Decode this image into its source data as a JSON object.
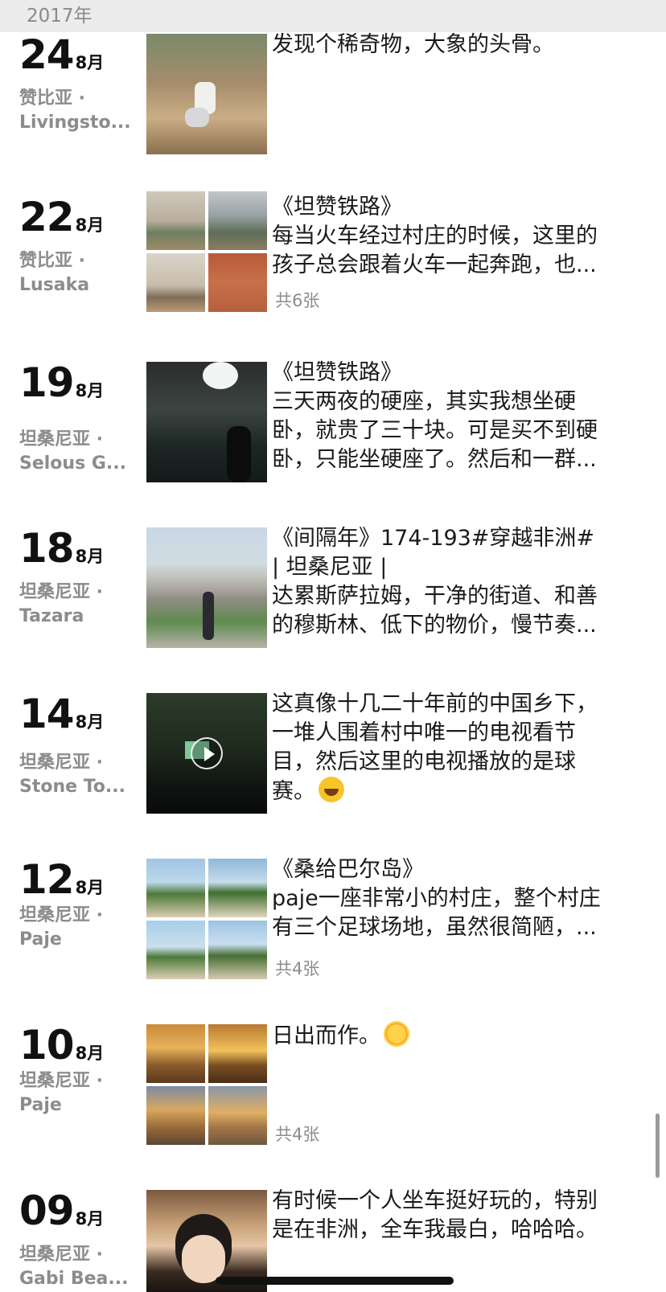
{
  "year_header": "2017年",
  "entries": [
    {
      "day": "24",
      "month": "8月",
      "place_line1": "赞比亚 ·",
      "place_line2": "Livingsto...",
      "lines": [
        "发现个稀奇物，大象的头骨。"
      ],
      "count": ""
    },
    {
      "day": "22",
      "month": "8月",
      "place_line1": "赞比亚 ·",
      "place_line2": "Lusaka",
      "lines": [
        "《坦赞铁路》",
        "每当火车经过村庄的时候，这里的",
        "孩子总会跟着火车一起奔跑，也..."
      ],
      "count": "共6张"
    },
    {
      "day": "19",
      "month": "8月",
      "place_line1": "坦桑尼亚 ·",
      "place_line2": "Selous G...",
      "lines": [
        "《坦赞铁路》",
        "三天两夜的硬座，其实我想坐硬",
        "卧，就贵了三十块。可是买不到硬",
        "卧，只能坐硬座了。然后和一群..."
      ],
      "count": ""
    },
    {
      "day": "18",
      "month": "8月",
      "place_line1": "坦桑尼亚 ·",
      "place_line2": "Tazara",
      "lines": [
        "《间隔年》174-193#穿越非洲#",
        "| 坦桑尼亚 |",
        "达累斯萨拉姆，干净的街道、和善",
        "的穆斯林、低下的物价，慢节奏..."
      ],
      "count": ""
    },
    {
      "day": "14",
      "month": "8月",
      "place_line1": "坦桑尼亚 ·",
      "place_line2": "Stone To...",
      "lines": [
        "这真像十几二十年前的中国乡下，",
        "一堆人围着村中唯一的电视看节",
        "目，然后这里的电视播放的是球",
        "赛。"
      ],
      "emoji": "laughing-tears-icon",
      "count": ""
    },
    {
      "day": "12",
      "month": "8月",
      "place_line1": "坦桑尼亚 ·",
      "place_line2": "Paje",
      "lines": [
        "《桑给巴尔岛》",
        "paje一座非常小的村庄，整个村庄",
        "有三个足球场地，虽然很简陋，..."
      ],
      "count": "共4张"
    },
    {
      "day": "10",
      "month": "8月",
      "place_line1": "坦桑尼亚 ·",
      "place_line2": "Paje",
      "lines": [
        "日出而作。"
      ],
      "emoji": "sun-face-icon",
      "count": "共4张"
    },
    {
      "day": "09",
      "month": "8月",
      "place_line1": "坦桑尼亚 ·",
      "place_line2": "Gabi Bea...",
      "lines": [
        "有时候一个人坐车挺好玩的，特别",
        "是在非洲，全车我最白，哈哈哈。"
      ],
      "count": ""
    }
  ],
  "colors": {
    "header_bg": "#ececec",
    "muted_text": "#8c8c8c",
    "primary_text": "#1a1a1a"
  }
}
